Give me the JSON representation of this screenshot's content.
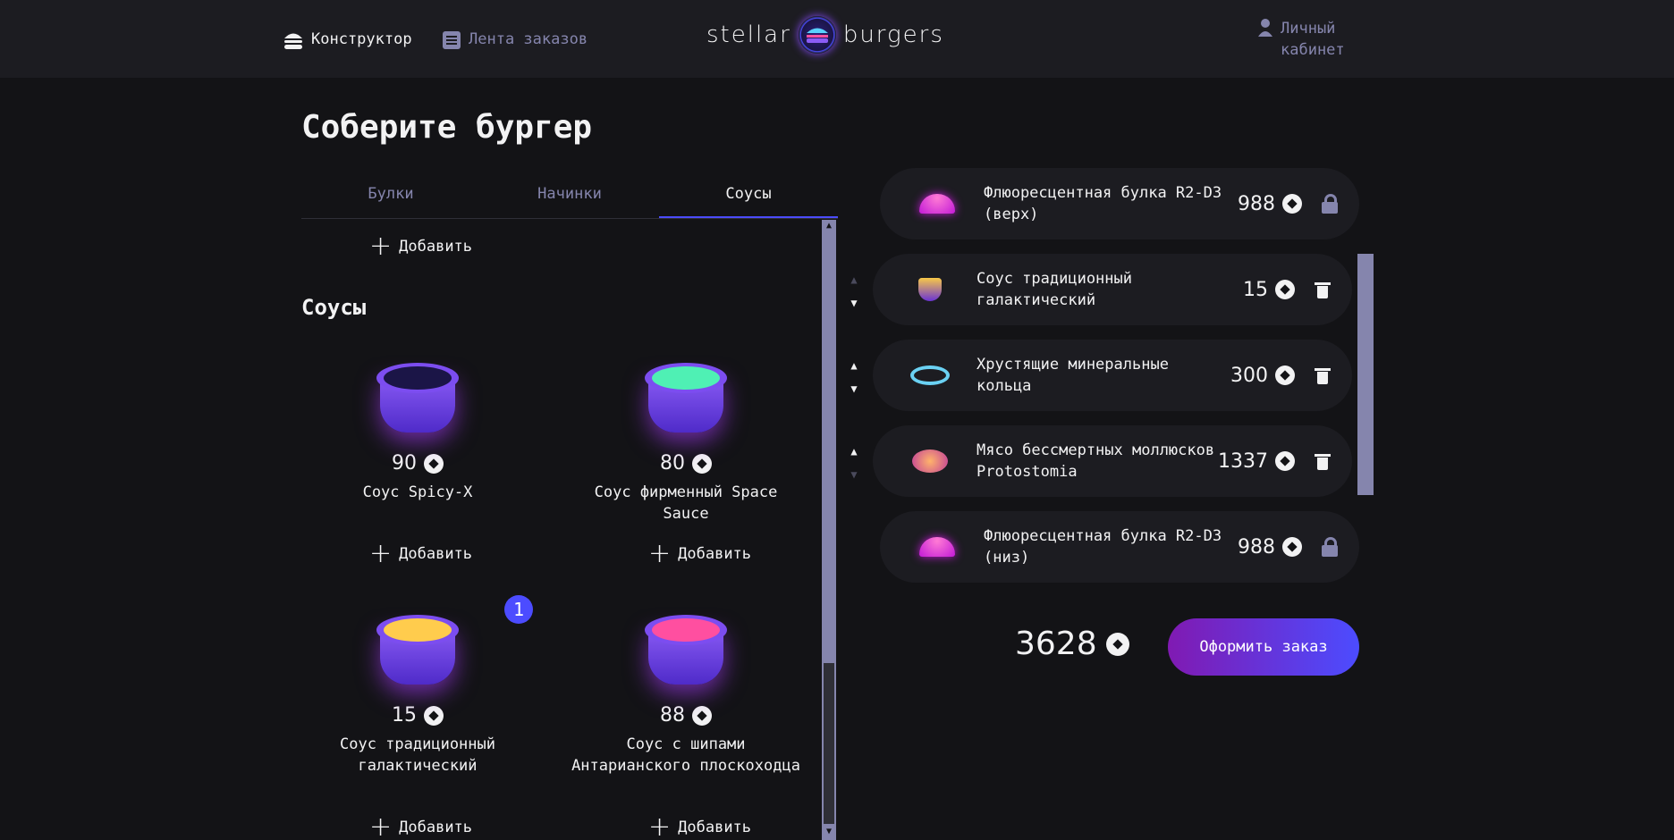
{
  "header": {
    "constructor_label": "Конструктор",
    "feed_label": "Лента заказов",
    "logo_left": "stellar",
    "logo_right": "burgers",
    "account_line1": "Личный",
    "account_line2": "кабинет"
  },
  "page_title": "Соберите бургер",
  "tabs": [
    {
      "label": "Булки",
      "active": false
    },
    {
      "label": "Начинки",
      "active": false
    },
    {
      "label": "Соусы",
      "active": true
    }
  ],
  "add_label": "Добавить",
  "section_title": "Соусы",
  "sauces": [
    {
      "price": "90",
      "name": "Соус Spicy-X",
      "fill": "#1b1547"
    },
    {
      "price": "80",
      "name": "Соус фирменный Space Sauce",
      "fill": "#4ff0b4"
    },
    {
      "price": "15",
      "name": "Соус традиционный галактический",
      "fill": "#ffcc4d",
      "count": "1"
    },
    {
      "price": "88",
      "name": "Соус с шипами Антарианского плоскоходца",
      "fill": "#ff4fa0"
    }
  ],
  "constructor": {
    "top_bun": {
      "name": "Флюоресцентная булка R2-D3 (верх)",
      "price": "988"
    },
    "fillings": [
      {
        "name": "Соус традиционный галактический",
        "price": "15"
      },
      {
        "name": "Хрустящие минеральные кольца",
        "price": "300"
      },
      {
        "name": "Мясо бессмертных моллюсков Protostomia",
        "price": "1337"
      }
    ],
    "bottom_bun": {
      "name": "Флюоресцентная булка R2-D3 (низ)",
      "price": "988"
    }
  },
  "total": "3628",
  "order_button": "Оформить заказ",
  "colors": {
    "accent": "#4c4cff",
    "background": "#131316",
    "panel": "#1c1c21",
    "inactive": "#8585ad"
  }
}
